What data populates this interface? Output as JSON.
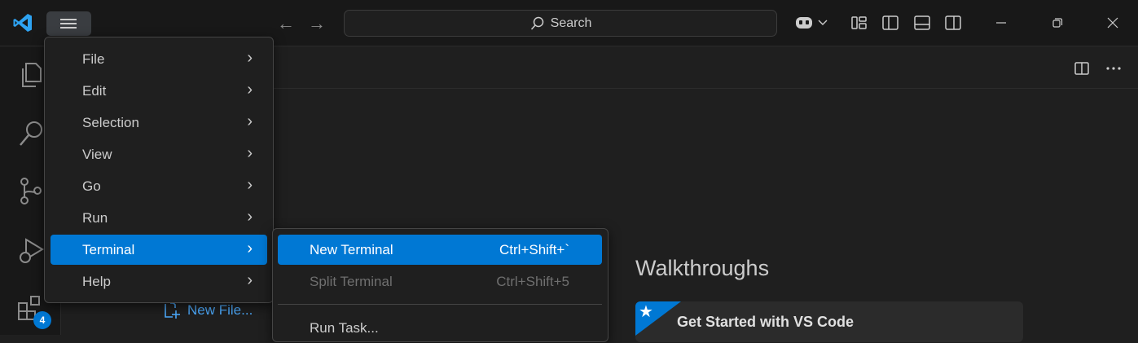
{
  "titlebar": {
    "search_placeholder": "Search",
    "nav_back": "←",
    "nav_forward": "→"
  },
  "main_menu": {
    "items": [
      {
        "label": "File"
      },
      {
        "label": "Edit"
      },
      {
        "label": "Selection"
      },
      {
        "label": "View"
      },
      {
        "label": "Go"
      },
      {
        "label": "Run"
      },
      {
        "label": "Terminal"
      },
      {
        "label": "Help"
      }
    ],
    "active_item": "Terminal"
  },
  "terminal_menu": {
    "items": [
      {
        "label": "New Terminal",
        "shortcut": "Ctrl+Shift+`",
        "state": "highlighted"
      },
      {
        "label": "Split Terminal",
        "shortcut": "Ctrl+Shift+5",
        "state": "disabled"
      },
      {
        "label": "Run Task...",
        "shortcut": "",
        "state": "normal"
      }
    ]
  },
  "activitybar": {
    "extensions_badge": "4",
    "icons": [
      "explorer-icon",
      "search-icon",
      "source-control-icon",
      "run-debug-icon",
      "extensions-icon"
    ]
  },
  "welcome": {
    "new_file_link": "New File...",
    "walkthroughs_title": "Walkthroughs",
    "walkthrough_card": "Get Started with VS Code"
  },
  "colors": {
    "accent": "#0078d4",
    "link": "#4daafc",
    "background": "#1f1f1f"
  }
}
